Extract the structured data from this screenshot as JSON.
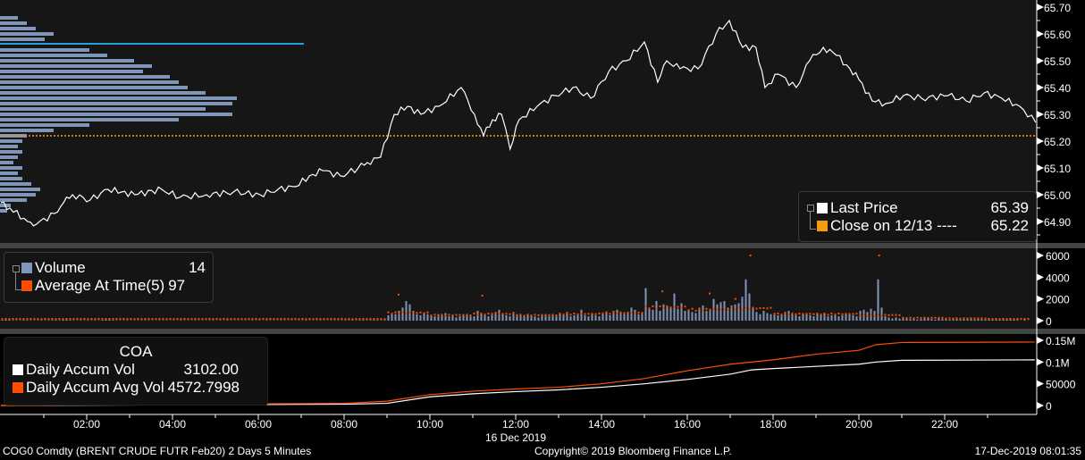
{
  "chart_data": [
    {
      "type": "line",
      "panel": "price",
      "series_name": "Last Price",
      "last_value": "65.39",
      "reference_line": {
        "label": "Close on 12/13 ----",
        "value_label": "65.22",
        "value": 65.22
      },
      "ylim": [
        64.84,
        65.72
      ],
      "yticks": [
        "65.70",
        "65.60",
        "65.50",
        "65.40",
        "65.30",
        "65.20",
        "65.10",
        "65.00",
        "64.90"
      ],
      "points_hour_price": [
        [
          0,
          64.97
        ],
        [
          0.21,
          64.95
        ],
        [
          0.62,
          64.9
        ],
        [
          0.83,
          64.89
        ],
        [
          1.25,
          64.93
        ],
        [
          1.46,
          64.97
        ],
        [
          1.67,
          65.0
        ],
        [
          2.08,
          64.98
        ],
        [
          2.5,
          65.02
        ],
        [
          2.81,
          65.01
        ],
        [
          3.12,
          65.0
        ],
        [
          3.75,
          65.02
        ],
        [
          4.17,
          64.99
        ],
        [
          4.79,
          65.0
        ],
        [
          5.42,
          65.01
        ],
        [
          6.04,
          65.0
        ],
        [
          6.46,
          65.02
        ],
        [
          6.87,
          65.03
        ],
        [
          7.19,
          65.07
        ],
        [
          7.5,
          65.09
        ],
        [
          7.92,
          65.07
        ],
        [
          8.33,
          65.1
        ],
        [
          8.54,
          65.12
        ],
        [
          8.85,
          65.14
        ],
        [
          9.17,
          65.3
        ],
        [
          9.48,
          65.33
        ],
        [
          9.79,
          65.3
        ],
        [
          10.21,
          65.33
        ],
        [
          10.73,
          65.4
        ],
        [
          11.04,
          65.3
        ],
        [
          11.25,
          65.22
        ],
        [
          11.46,
          65.28
        ],
        [
          11.67,
          65.3
        ],
        [
          11.87,
          65.17
        ],
        [
          12.08,
          65.28
        ],
        [
          12.5,
          65.33
        ],
        [
          12.92,
          65.37
        ],
        [
          13.33,
          65.4
        ],
        [
          13.75,
          65.36
        ],
        [
          14.17,
          65.46
        ],
        [
          14.58,
          65.5
        ],
        [
          15.0,
          65.57
        ],
        [
          15.31,
          65.42
        ],
        [
          15.52,
          65.5
        ],
        [
          15.83,
          65.47
        ],
        [
          16.25,
          65.47
        ],
        [
          16.67,
          65.6
        ],
        [
          16.98,
          65.65
        ],
        [
          17.29,
          65.55
        ],
        [
          17.6,
          65.55
        ],
        [
          17.81,
          65.4
        ],
        [
          18.12,
          65.45
        ],
        [
          18.54,
          65.4
        ],
        [
          18.85,
          65.5
        ],
        [
          19.17,
          65.55
        ],
        [
          19.48,
          65.52
        ],
        [
          19.79,
          65.47
        ],
        [
          20.0,
          65.43
        ],
        [
          20.31,
          65.35
        ],
        [
          20.62,
          65.34
        ],
        [
          21.04,
          65.37
        ],
        [
          21.46,
          65.36
        ],
        [
          22.08,
          65.37
        ],
        [
          22.5,
          65.35
        ],
        [
          22.92,
          65.38
        ],
        [
          23.33,
          65.36
        ],
        [
          23.75,
          65.33
        ],
        [
          24.12,
          65.27
        ]
      ],
      "volume_profile_price_volume": [
        [
          65.66,
          20
        ],
        [
          65.64,
          30
        ],
        [
          65.62,
          40
        ],
        [
          65.6,
          60
        ],
        [
          65.58,
          50
        ],
        [
          65.56,
          340
        ],
        [
          65.54,
          100
        ],
        [
          65.52,
          120
        ],
        [
          65.5,
          150
        ],
        [
          65.48,
          170
        ],
        [
          65.46,
          160
        ],
        [
          65.44,
          190
        ],
        [
          65.42,
          200
        ],
        [
          65.4,
          210
        ],
        [
          65.38,
          230
        ],
        [
          65.36,
          265
        ],
        [
          65.34,
          260
        ],
        [
          65.32,
          230
        ],
        [
          65.3,
          260
        ],
        [
          65.28,
          200
        ],
        [
          65.26,
          100
        ],
        [
          65.24,
          60
        ],
        [
          65.22,
          30
        ],
        [
          65.2,
          25
        ],
        [
          65.18,
          20
        ],
        [
          65.16,
          25
        ],
        [
          65.14,
          20
        ],
        [
          65.12,
          15
        ],
        [
          65.1,
          25
        ],
        [
          65.08,
          20
        ],
        [
          65.06,
          25
        ],
        [
          65.04,
          35
        ],
        [
          65.02,
          45
        ],
        [
          65.0,
          40
        ],
        [
          64.98,
          30
        ],
        [
          64.96,
          12
        ],
        [
          64.94,
          8
        ]
      ],
      "volume_profile_highlight_price": 65.56
    },
    {
      "type": "bar",
      "panel": "volume",
      "ylim": [
        0,
        6500
      ],
      "yticks": [
        "6000",
        "4000",
        "2000",
        "0"
      ],
      "ytick_values": [
        6000,
        4000,
        2000,
        0
      ],
      "interval_minutes": 5,
      "volume": [
        60,
        120,
        80,
        50,
        40,
        30,
        60,
        50,
        40,
        30,
        50,
        40,
        40,
        30,
        50,
        60,
        40,
        200,
        80,
        60,
        40,
        30,
        50,
        40,
        30,
        40,
        50,
        30,
        60,
        200,
        220,
        60,
        40,
        30,
        40,
        30,
        30,
        20,
        40,
        30,
        50,
        40,
        30,
        20,
        30,
        40,
        30,
        20,
        20,
        30,
        40,
        30,
        20,
        30,
        40,
        20,
        30,
        20,
        30,
        40,
        20,
        30,
        20,
        40,
        30,
        20,
        30,
        20,
        30,
        20,
        40,
        30,
        30,
        20,
        40,
        30,
        20,
        30,
        40,
        30,
        20,
        30,
        20,
        30,
        30,
        40,
        30,
        20,
        30,
        40,
        30,
        20,
        30,
        40,
        30,
        40,
        40,
        50,
        60,
        40,
        50,
        60,
        40,
        50,
        60,
        50,
        40,
        60,
        500,
        700,
        600,
        900,
        1200,
        1800,
        1500,
        900,
        600,
        500,
        700,
        600,
        500,
        400,
        600,
        500,
        700,
        400,
        500,
        300,
        400,
        600,
        500,
        400,
        400,
        900,
        600,
        500,
        400,
        700,
        800,
        1000,
        600,
        500,
        400,
        800,
        600,
        500,
        400,
        600,
        500,
        400,
        300,
        500,
        600,
        400,
        500,
        400,
        600,
        500,
        800,
        400,
        500,
        600,
        1000,
        500,
        400,
        600,
        500,
        400,
        600,
        700,
        500,
        900,
        1000,
        700,
        600,
        800,
        1200,
        1000,
        600,
        800,
        3000,
        1200,
        1000,
        1800,
        900,
        1500,
        1400,
        1200,
        2500,
        1100,
        1600,
        900,
        1000,
        800,
        700,
        1200,
        1400,
        900,
        1100,
        2000,
        1500,
        1700,
        1800,
        1200,
        1400,
        1500,
        1600,
        2200,
        3800,
        2500,
        1200,
        800,
        600,
        900,
        700,
        600,
        700,
        500,
        600,
        800,
        900,
        600,
        500,
        400,
        600,
        700,
        500,
        400,
        600,
        500,
        700,
        400,
        500,
        600,
        400,
        500,
        600,
        700,
        500,
        400,
        900,
        1000,
        800,
        1100,
        900,
        3800,
        1200,
        400,
        300,
        200,
        300,
        200,
        200,
        300,
        150,
        200,
        100,
        150,
        200,
        250,
        150,
        100,
        200,
        150,
        150,
        100,
        200,
        150,
        100,
        150,
        200,
        150,
        100,
        150,
        120,
        100,
        100,
        150,
        120,
        80,
        100,
        120,
        200,
        150,
        60,
        0,
        80,
        14
      ],
      "avg_at_time_hourly": [
        150,
        150,
        150,
        150,
        150,
        150,
        150,
        150,
        150,
        700,
        500,
        600,
        500,
        600,
        700,
        1200,
        1000,
        1100,
        600,
        600,
        500,
        250,
        200,
        150
      ],
      "avg_spikes_hour_value": [
        [
          11.2,
          2300
        ],
        [
          9.25,
          2400
        ],
        [
          15.4,
          2700
        ],
        [
          16.5,
          2500
        ],
        [
          17.1,
          2000
        ],
        [
          17.45,
          6000
        ],
        [
          20.45,
          6000
        ]
      ],
      "legend": [
        {
          "label": "Volume",
          "value": "14"
        },
        {
          "label": "Average At Time(5)",
          "value": "97"
        }
      ]
    },
    {
      "type": "line",
      "panel": "accumulated volume",
      "title": "COA",
      "ylim": [
        -8000,
        165000
      ],
      "yticks": [
        "0.15M",
        "0.1M",
        "50000",
        "0"
      ],
      "ytick_values": [
        150000,
        100000,
        50000,
        0
      ],
      "series": [
        {
          "name": "Daily Accum Vol",
          "value": "3102.00",
          "points_hour_value": [
            [
              0,
              0
            ],
            [
              8,
              3000
            ],
            [
              9,
              5000
            ],
            [
              10,
              20000
            ],
            [
              11,
              27000
            ],
            [
              12,
              32000
            ],
            [
              13,
              36000
            ],
            [
              14,
              42000
            ],
            [
              15,
              50000
            ],
            [
              16,
              60000
            ],
            [
              17,
              72000
            ],
            [
              17.5,
              82000
            ],
            [
              18,
              85000
            ],
            [
              19,
              90000
            ],
            [
              20,
              95000
            ],
            [
              20.4,
              100000
            ],
            [
              21,
              104000
            ],
            [
              24.1,
              105000
            ]
          ]
        },
        {
          "name": "Daily Accum Avg Vol",
          "value": "4572.7998",
          "points_hour_value": [
            [
              0,
              0
            ],
            [
              8,
              5000
            ],
            [
              9,
              10000
            ],
            [
              10,
              25000
            ],
            [
              11,
              33000
            ],
            [
              12,
              38000
            ],
            [
              13,
              42000
            ],
            [
              14,
              50000
            ],
            [
              15,
              62000
            ],
            [
              16,
              80000
            ],
            [
              17,
              95000
            ],
            [
              18,
              105000
            ],
            [
              19,
              118000
            ],
            [
              20,
              127000
            ],
            [
              20.4,
              140000
            ],
            [
              21,
              145000
            ],
            [
              24.1,
              146000
            ]
          ]
        }
      ]
    }
  ],
  "xaxis": {
    "ticks": [
      {
        "label": "02:00",
        "hour": 2
      },
      {
        "label": "04:00",
        "hour": 4
      },
      {
        "label": "06:00",
        "hour": 6
      },
      {
        "label": "08:00",
        "hour": 8
      },
      {
        "label": "10:00",
        "hour": 10
      },
      {
        "label": "12:00",
        "hour": 12
      },
      {
        "label": "14:00",
        "hour": 14
      },
      {
        "label": "16:00",
        "hour": 16
      },
      {
        "label": "18:00",
        "hour": 18
      },
      {
        "label": "20:00",
        "hour": 20
      },
      {
        "label": "22:00",
        "hour": 22
      }
    ],
    "date_label": "16 Dec 2019"
  },
  "colors": {
    "price": "#ffffff",
    "close": "#f39c12",
    "volume": "#7f96b8",
    "avg": "#ff4e00",
    "accum": "#ffffff",
    "accum_avg": "#ff4e00",
    "highlight": "#1fa4d6"
  },
  "status_bar": {
    "security": "COG0 Comdty (BRENT CRUDE FUTR  Feb20) 2 Days 5 Minutes",
    "copyright": "Copyright© 2019 Bloomberg Finance L.P.",
    "timestamp": "17-Dec-2019 08:01:35"
  }
}
